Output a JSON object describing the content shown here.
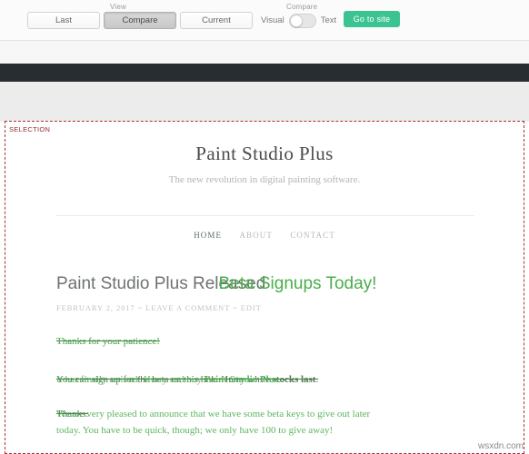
{
  "toolbar": {
    "view_group_label": "View",
    "compare_group_label": "Compare",
    "view_buttons": [
      {
        "label": "Last",
        "active": false
      },
      {
        "label": "Compare",
        "active": true
      },
      {
        "label": "Current",
        "active": false
      }
    ],
    "toggle_left_label": "Visual",
    "toggle_right_label": "Text",
    "toggle_state": "Visual",
    "goto_site_label": "Go to site",
    "goto_site_color": "#3bc492",
    "dark_bar_color": "#282d32"
  },
  "selection": {
    "badge_label": "SELECTION",
    "border_color": "#a83030"
  },
  "site": {
    "title": "Paint Studio Plus",
    "tagline": "The new revolution in digital painting software.",
    "nav": [
      {
        "label": "HOME",
        "current": true
      },
      {
        "label": "ABOUT",
        "current": false
      },
      {
        "label": "CONTACT",
        "current": false
      }
    ]
  },
  "post": {
    "title_old": "Paint Studio Plus Released",
    "title_new": "Beta Signups Today!",
    "meta_date": "FEBRUARY 2, 2017",
    "meta_sep_1": "~",
    "meta_comment": "LEAVE A COMMENT",
    "meta_sep_2": "~",
    "meta_edit": "EDIT",
    "old_version": {
      "para_1": "Thanks for your patience!",
      "para_2_a": "You can sign up for the beta on this link. Hurry while ",
      "para_2_bold": "stocks last",
      "para_2_b": ".",
      "para_3": "Thanks."
    },
    "new_version": {
      "para_1": "Thanks for your patience!",
      "para_2_a": "It has finally arrived! Hurry and buy ",
      "para_2_bold": "Paint Studio Plus",
      "para_2_b": ".",
      "para_3_line1": "We are very pleased to announce that we have some beta keys to give out later",
      "para_3_line2": "today. You have to be quick, though; we only have 100 to give away!"
    }
  },
  "watermark": "wsxdn.com",
  "colors": {
    "diff_old_text": "#6f7272",
    "diff_new_text": "#49ae4c",
    "body_old_text": "#4e7a4e",
    "body_new_text": "#5cb65f"
  }
}
